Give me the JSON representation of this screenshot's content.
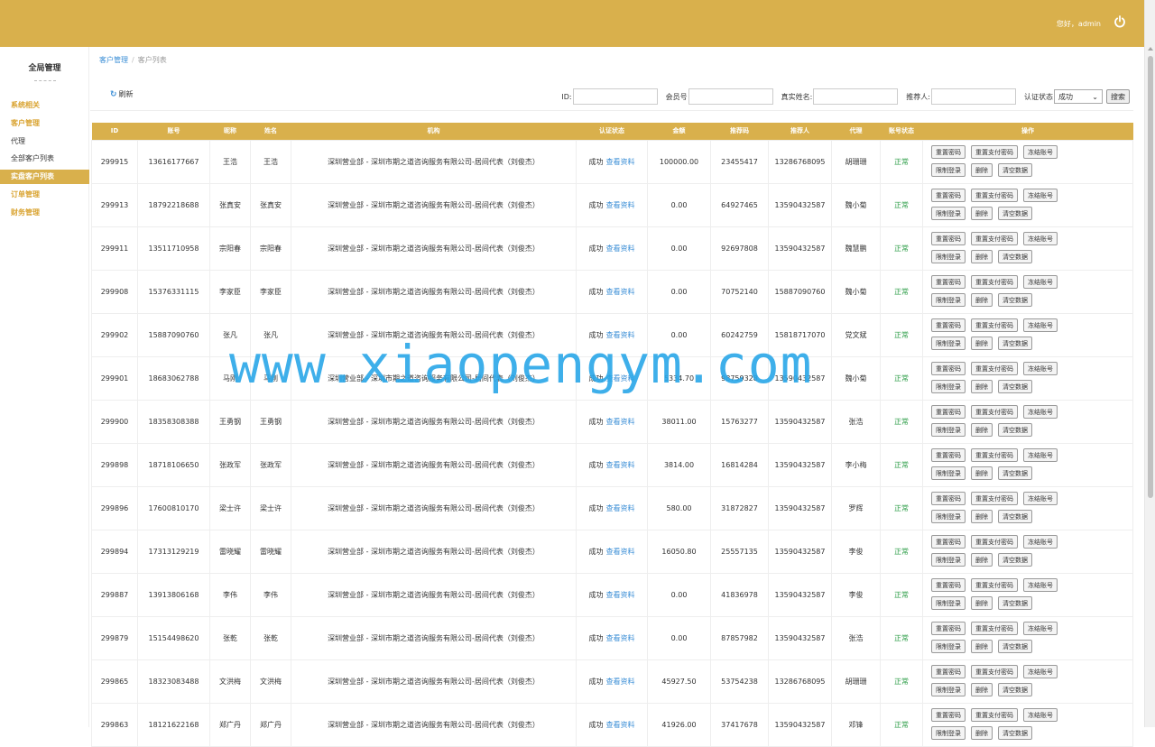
{
  "header": {
    "greeting": "您好，admin"
  },
  "sidebar": {
    "title": "全局管理",
    "items": [
      {
        "label": "系统相关",
        "kind": "cat"
      },
      {
        "label": "客户管理",
        "kind": "cat"
      },
      {
        "label": "代理",
        "kind": "sub"
      },
      {
        "label": "全部客户列表",
        "kind": "sub"
      },
      {
        "label": "实盘客户列表",
        "kind": "active"
      },
      {
        "label": "订单管理",
        "kind": "cat"
      },
      {
        "label": "财务管理",
        "kind": "cat"
      }
    ]
  },
  "breadcrumb": {
    "parent": "客户管理",
    "separator": "/",
    "current": "客户列表"
  },
  "toolbar": {
    "refresh_label": "刷新"
  },
  "filters": {
    "id_label": "ID:",
    "member_label": "会员号",
    "realname_label": "真实姓名:",
    "referrer_label": "推荐人:",
    "auth_label": "认证状态",
    "auth_selected": "成功",
    "search_label": "搜索"
  },
  "table": {
    "columns": [
      "ID",
      "账号",
      "昵称",
      "姓名",
      "机构",
      "认证状态",
      "金额",
      "推荐码",
      "推荐人",
      "代理",
      "账号状态",
      "操作"
    ],
    "view_label": "查看资料",
    "ops": [
      "重置密码",
      "重置支付密码",
      "冻结账号",
      "限制登录",
      "删除",
      "清空数据"
    ],
    "rows": [
      {
        "id": "299915",
        "account": "13616177667",
        "nick": "王浩",
        "name": "王浩",
        "org": "深圳营业部 - 深圳市期之道咨询服务有限公司-居间代表（刘俊杰）",
        "auth": "成功",
        "amount": "100000.00",
        "code": "23455417",
        "referrer": "13286768095",
        "agent": "胡珊珊",
        "status": "正常"
      },
      {
        "id": "299913",
        "account": "18792218688",
        "nick": "张真安",
        "name": "张真安",
        "org": "深圳营业部 - 深圳市期之道咨询服务有限公司-居间代表（刘俊杰）",
        "auth": "成功",
        "amount": "0.00",
        "code": "64927465",
        "referrer": "13590432587",
        "agent": "魏小菊",
        "status": "正常"
      },
      {
        "id": "299911",
        "account": "13511710958",
        "nick": "宗阳春",
        "name": "宗阳春",
        "org": "深圳营业部 - 深圳市期之道咨询服务有限公司-居间代表（刘俊杰）",
        "auth": "成功",
        "amount": "0.00",
        "code": "92697808",
        "referrer": "13590432587",
        "agent": "魏慧鹏",
        "status": "正常"
      },
      {
        "id": "299908",
        "account": "15376331115",
        "nick": "李家臣",
        "name": "李家臣",
        "org": "深圳营业部 - 深圳市期之道咨询服务有限公司-居间代表（刘俊杰）",
        "auth": "成功",
        "amount": "0.00",
        "code": "70752140",
        "referrer": "15887090760",
        "agent": "魏小菊",
        "status": "正常"
      },
      {
        "id": "299902",
        "account": "15887090760",
        "nick": "张凡",
        "name": "张凡",
        "org": "深圳营业部 - 深圳市期之道咨询服务有限公司-居间代表（刘俊杰）",
        "auth": "成功",
        "amount": "0.00",
        "code": "60242759",
        "referrer": "15818717070",
        "agent": "党文斌",
        "status": "正常"
      },
      {
        "id": "299901",
        "account": "18683062788",
        "nick": "马刚",
        "name": "马刚",
        "org": "深圳营业部 - 深圳市期之道咨询服务有限公司-居间代表（刘俊杰）",
        "auth": "成功",
        "amount": "5334.70",
        "code": "98759328",
        "referrer": "13590432587",
        "agent": "魏小菊",
        "status": "正常"
      },
      {
        "id": "299900",
        "account": "18358308388",
        "nick": "王勇钢",
        "name": "王勇钢",
        "org": "深圳营业部 - 深圳市期之道咨询服务有限公司-居间代表（刘俊杰）",
        "auth": "成功",
        "amount": "38011.00",
        "code": "15763277",
        "referrer": "13590432587",
        "agent": "张浩",
        "status": "正常"
      },
      {
        "id": "299898",
        "account": "18718106650",
        "nick": "张政军",
        "name": "张政军",
        "org": "深圳营业部 - 深圳市期之道咨询服务有限公司-居间代表（刘俊杰）",
        "auth": "成功",
        "amount": "3814.00",
        "code": "16814284",
        "referrer": "13590432587",
        "agent": "李小梅",
        "status": "正常"
      },
      {
        "id": "299896",
        "account": "17600810170",
        "nick": "梁士许",
        "name": "梁士许",
        "org": "深圳营业部 - 深圳市期之道咨询服务有限公司-居间代表（刘俊杰）",
        "auth": "成功",
        "amount": "580.00",
        "code": "31872827",
        "referrer": "13590432587",
        "agent": "罗辉",
        "status": "正常"
      },
      {
        "id": "299894",
        "account": "17313129219",
        "nick": "雷晓耀",
        "name": "雷晓耀",
        "org": "深圳营业部 - 深圳市期之道咨询服务有限公司-居间代表（刘俊杰）",
        "auth": "成功",
        "amount": "16050.80",
        "code": "25557135",
        "referrer": "13590432587",
        "agent": "李俊",
        "status": "正常"
      },
      {
        "id": "299887",
        "account": "13913806168",
        "nick": "李伟",
        "name": "李伟",
        "org": "深圳营业部 - 深圳市期之道咨询服务有限公司-居间代表（刘俊杰）",
        "auth": "成功",
        "amount": "0.00",
        "code": "41836978",
        "referrer": "13590432587",
        "agent": "李俊",
        "status": "正常"
      },
      {
        "id": "299879",
        "account": "15154498620",
        "nick": "张乾",
        "name": "张乾",
        "org": "深圳营业部 - 深圳市期之道咨询服务有限公司-居间代表（刘俊杰）",
        "auth": "成功",
        "amount": "0.00",
        "code": "87857982",
        "referrer": "13590432587",
        "agent": "张浩",
        "status": "正常"
      },
      {
        "id": "299865",
        "account": "18323083488",
        "nick": "文洪梅",
        "name": "文洪梅",
        "org": "深圳营业部 - 深圳市期之道咨询服务有限公司-居间代表（刘俊杰）",
        "auth": "成功",
        "amount": "45927.50",
        "code": "53754238",
        "referrer": "13286768095",
        "agent": "胡珊珊",
        "status": "正常"
      },
      {
        "id": "299863",
        "account": "18121622168",
        "nick": "郑广丹",
        "name": "郑广丹",
        "org": "深圳营业部 - 深圳市期之道咨询服务有限公司-居间代表（刘俊杰）",
        "auth": "成功",
        "amount": "41926.00",
        "code": "37417678",
        "referrer": "13590432587",
        "agent": "邓锋",
        "status": "正常"
      }
    ]
  },
  "watermark": "www.xiaopengym.com"
}
